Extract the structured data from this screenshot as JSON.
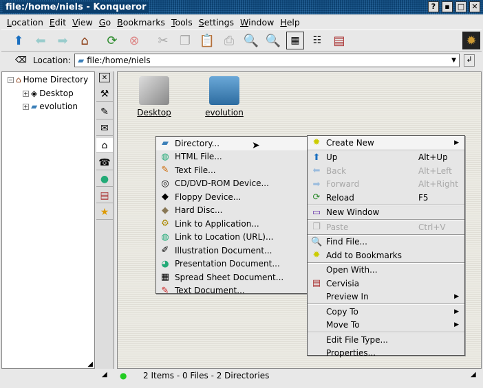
{
  "window": {
    "title": "file:/home/niels - Konqueror",
    "buttons": [
      "?",
      "▪",
      "□",
      "✕"
    ]
  },
  "menubar": [
    "Location",
    "Edit",
    "View",
    "Go",
    "Bookmarks",
    "Tools",
    "Settings",
    "Window",
    "Help"
  ],
  "toolbar": [
    "up-icon",
    "back-icon",
    "forward-icon",
    "home-icon",
    "reload-icon",
    "stop-icon",
    "cut-icon",
    "copy-icon",
    "paste-icon",
    "print-icon",
    "zoom-in-icon",
    "zoom-out-icon",
    "icon-view-icon",
    "tree-view-icon",
    "cervisia-icon"
  ],
  "location": {
    "label": "Location:",
    "value": "file:/home/niels"
  },
  "tree": {
    "root": "Home Directory",
    "items": [
      "Desktop",
      "evolution"
    ]
  },
  "files": [
    "Desktop",
    "evolution"
  ],
  "create_new_menu": [
    "Directory...",
    "HTML File...",
    "Text File...",
    "CD/DVD-ROM Device...",
    "Floppy Device...",
    "Hard Disc...",
    "Link to Application...",
    "Link to Location (URL)...",
    "Illustration Document...",
    "Presentation Document...",
    "Spread Sheet Document...",
    "Text Document..."
  ],
  "context_menu": {
    "create_new": "Create New",
    "up": "Up",
    "up_sc": "Alt+Up",
    "back": "Back",
    "back_sc": "Alt+Left",
    "forward": "Forward",
    "forward_sc": "Alt+Right",
    "reload": "Reload",
    "reload_sc": "F5",
    "new_window": "New Window",
    "paste": "Paste",
    "paste_sc": "Ctrl+V",
    "find_file": "Find File...",
    "add_bookmarks": "Add to Bookmarks",
    "open_with": "Open With...",
    "cervisia": "Cervisia",
    "preview_in": "Preview In",
    "copy_to": "Copy To",
    "move_to": "Move To",
    "edit_file_type": "Edit File Type...",
    "properties": "Properties..."
  },
  "status": {
    "text": "2 Items - 0 Files - 2 Directories"
  }
}
